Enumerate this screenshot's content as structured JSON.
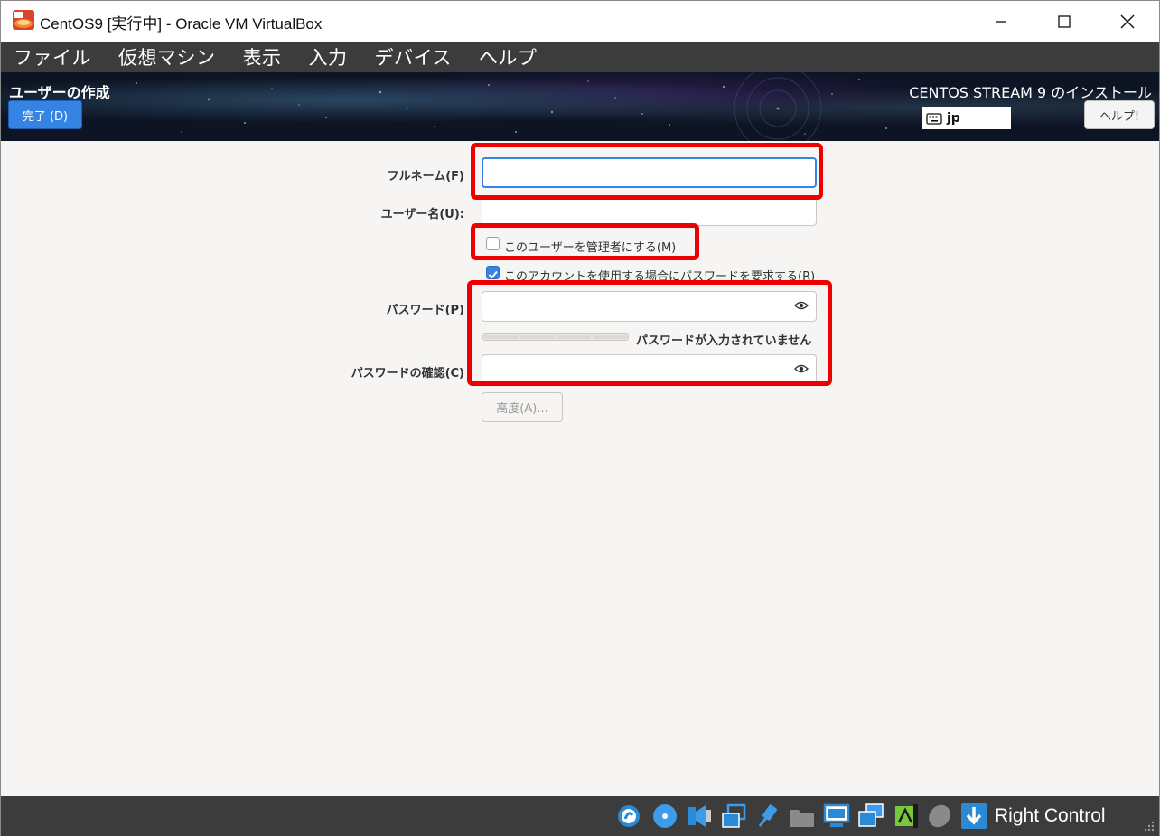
{
  "window": {
    "title": "CentOS9 [実行中] - Oracle VM VirtualBox"
  },
  "menu": [
    "ファイル",
    "仮想マシン",
    "表示",
    "入力",
    "デバイス",
    "ヘルプ"
  ],
  "header": {
    "spoke_title": "ユーザーの作成",
    "done_label": "完了 (D)",
    "install_title": "CENTOS STREAM 9 のインストール",
    "keyboard_layout": "jp",
    "help_label": "ヘルプ!"
  },
  "form": {
    "fullname_label": "フルネーム(F)",
    "fullname_value": "",
    "username_label": "ユーザー名(U):",
    "username_value": "",
    "admin_checkbox_label": "このユーザーを管理者にする(M)",
    "admin_checked": false,
    "require_password_label": "このアカウントを使用する場合にパスワードを要求する(R)",
    "require_password_checked": true,
    "password_label": "パスワード(P)",
    "password_value": "",
    "strength_text": "パスワードが入力されていません",
    "confirm_label": "パスワードの確認(C)",
    "confirm_value": "",
    "advanced_label": "高度(A)..."
  },
  "statusbar": {
    "host_key": "Right Control",
    "icons": [
      "hard-disk-icon",
      "optical-drive-icon",
      "audio-icon",
      "network-icon",
      "usb-icon",
      "shared-folders-icon",
      "display-icon",
      "video-capture-icon",
      "cpu-activity-icon",
      "mouse-integration-icon",
      "host-key-arrow-icon"
    ]
  },
  "colors": {
    "accent": "#3584e4",
    "highlight": "#ee0000",
    "menubar": "#3c3c3c"
  }
}
